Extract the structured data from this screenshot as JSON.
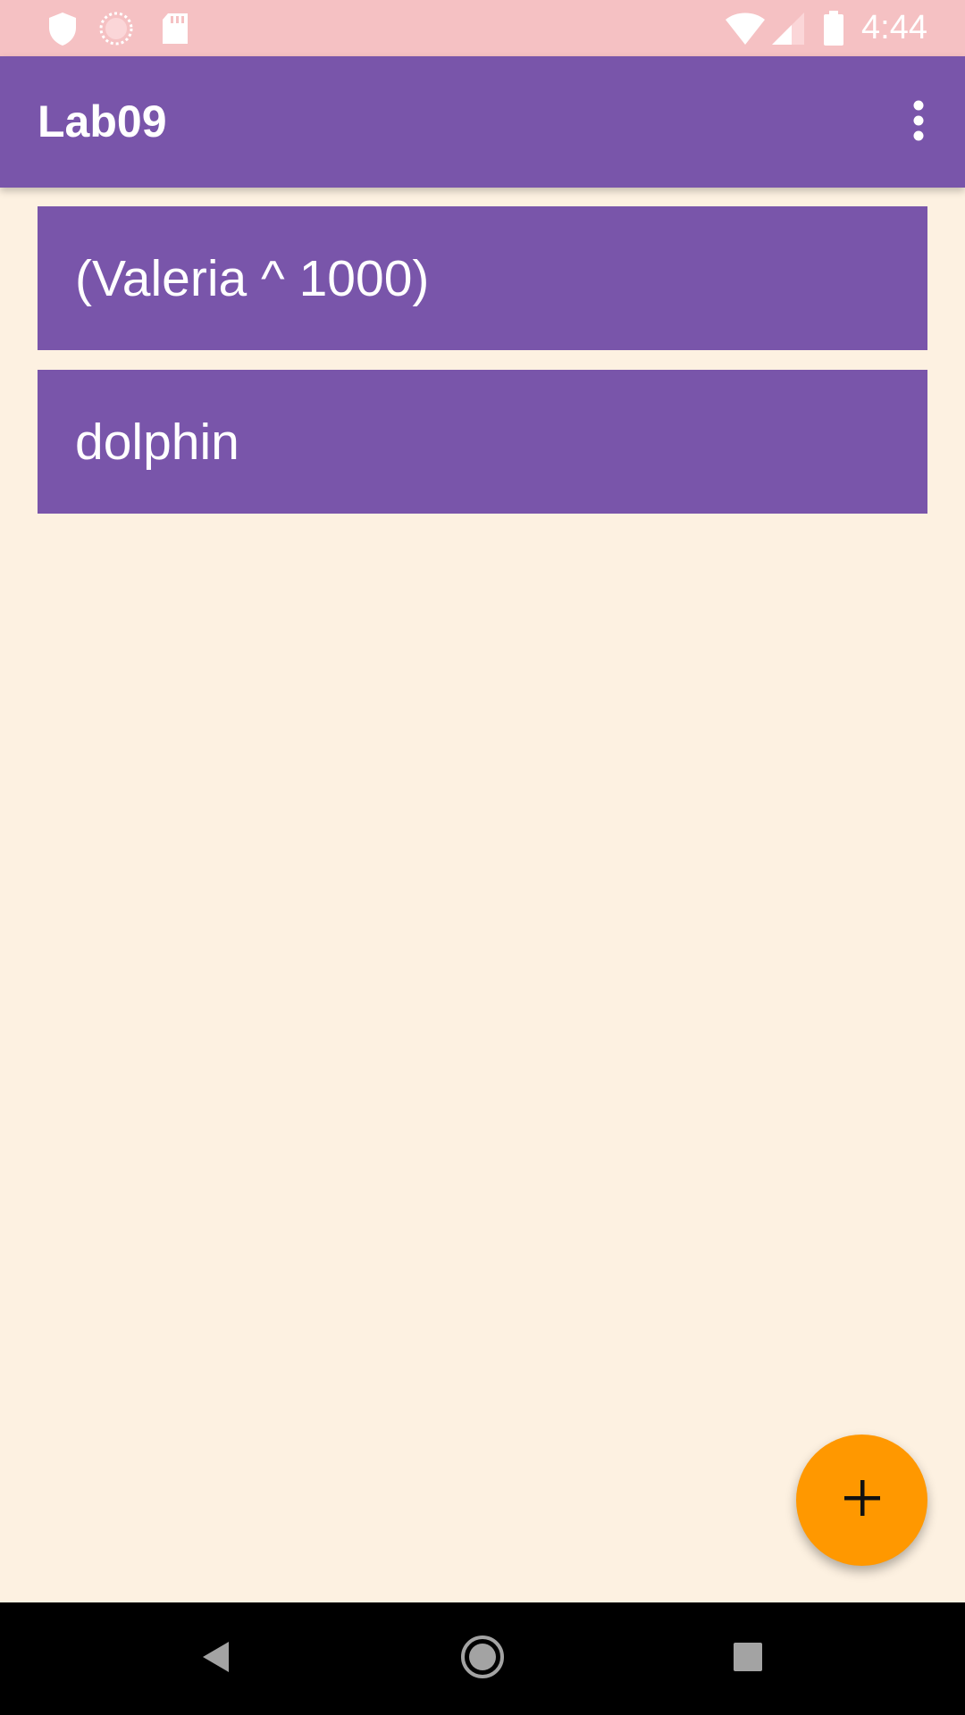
{
  "status_bar": {
    "time": "4:44",
    "left_icons": [
      "shield-icon",
      "sync-circle-icon",
      "sd-card-icon"
    ],
    "right_icons": [
      "wifi-icon",
      "cell-signal-icon",
      "battery-icon"
    ]
  },
  "app_bar": {
    "title": "Lab09",
    "menu_icon": "more-vert-icon"
  },
  "list": {
    "items": [
      {
        "label": "(Valeria ^ 1000)"
      },
      {
        "label": "dolphin"
      }
    ]
  },
  "fab": {
    "icon": "plus-icon"
  },
  "nav_bar": {
    "buttons": [
      "back-icon",
      "home-icon",
      "recents-icon"
    ]
  },
  "colors": {
    "status_bar": "#f5c1c3",
    "primary": "#7955aa",
    "background": "#fdf1e1",
    "accent": "#ff9800",
    "nav_bar": "#000000"
  }
}
